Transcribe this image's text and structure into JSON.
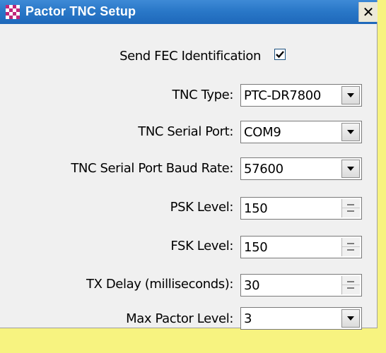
{
  "window": {
    "title": "Pactor TNC Setup",
    "close_glyph": "✕"
  },
  "fec": {
    "label": "Send FEC Identification",
    "checked": true
  },
  "fields": {
    "tnc_type": {
      "label": "TNC Type:",
      "value": "PTC-DR7800"
    },
    "serial_port": {
      "label": "TNC Serial Port:",
      "value": "COM9"
    },
    "baud_rate": {
      "label": "TNC Serial Port Baud Rate:",
      "value": "57600"
    },
    "psk_level": {
      "label": "PSK Level:",
      "value": "150"
    },
    "fsk_level": {
      "label": "FSK Level:",
      "value": "150"
    },
    "tx_delay": {
      "label": "TX Delay (milliseconds):",
      "value": "30"
    },
    "max_pactor": {
      "label": "Max Pactor Level:",
      "value": "3"
    }
  },
  "icons": {
    "app": "checkered-app-icon",
    "close": "close-icon",
    "check": "checkmark-icon",
    "dropdown": "chevron-down-icon",
    "spin_up": "spin-up-icon",
    "spin_down": "spin-down-icon"
  },
  "colors": {
    "titlebar": "#2a78c8",
    "window_bg": "#f0f0f0",
    "backdrop": "#f7f380",
    "app_icon_a": "#c0267a",
    "app_icon_b": "#ffffff"
  }
}
